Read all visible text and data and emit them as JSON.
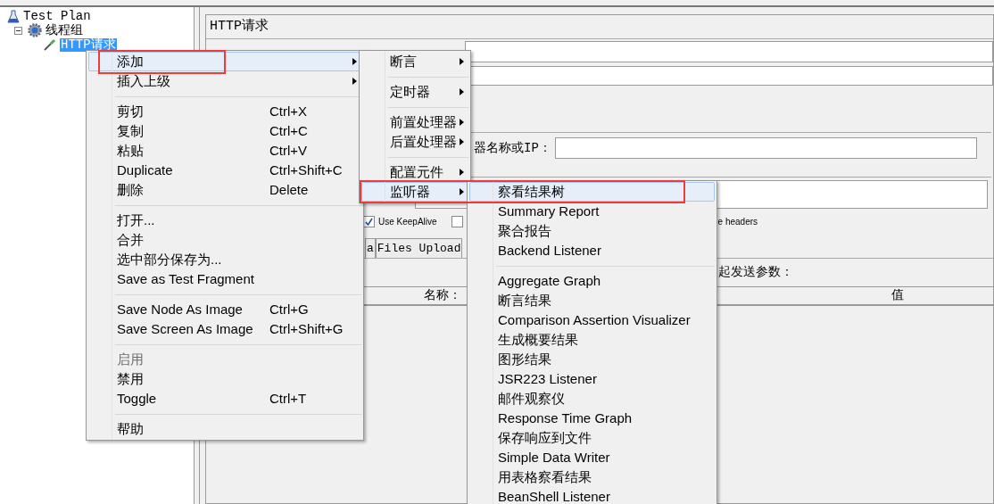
{
  "tree": [
    {
      "label": "Test Plan",
      "kind": "plan",
      "selected": false,
      "children": [
        {
          "label": "线程组",
          "kind": "group",
          "expanded": true,
          "selected": false,
          "children": [
            {
              "label": "HTTP请求",
              "kind": "sampler",
              "selected": true
            }
          ]
        }
      ]
    }
  ],
  "panel": {
    "title": "HTTP请求",
    "server_label": "器名称或IP：",
    "keepalive": {
      "label": "Use KeepAlive",
      "checked": true
    },
    "checkbox_2": {
      "checked": false
    },
    "headers_label": "e headers",
    "tabs": [
      {
        "label": "a",
        "selected": false
      },
      {
        "label": "Files Upload",
        "selected": false
      }
    ],
    "params_label": "起发送参数：",
    "table": {
      "columns": [
        "名称：",
        "值"
      ]
    }
  },
  "context_menu": {
    "items": [
      {
        "kind": "item",
        "label": "添加",
        "has_submenu": true,
        "selected": true,
        "disabled": false
      },
      {
        "kind": "item",
        "label": "插入上级",
        "has_submenu": true,
        "selected": false,
        "disabled": false
      },
      {
        "kind": "separator"
      },
      {
        "kind": "item",
        "label": "剪切",
        "shortcut": "Ctrl+X",
        "has_submenu": false,
        "selected": false,
        "disabled": false
      },
      {
        "kind": "item",
        "label": "复制",
        "shortcut": "Ctrl+C",
        "has_submenu": false,
        "selected": false,
        "disabled": false
      },
      {
        "kind": "item",
        "label": "粘贴",
        "shortcut": "Ctrl+V",
        "has_submenu": false,
        "selected": false,
        "disabled": false
      },
      {
        "kind": "item",
        "label": "Duplicate",
        "shortcut": "Ctrl+Shift+C",
        "has_submenu": false,
        "selected": false,
        "disabled": false
      },
      {
        "kind": "item",
        "label": "删除",
        "shortcut": "Delete",
        "has_submenu": false,
        "selected": false,
        "disabled": false
      },
      {
        "kind": "separator"
      },
      {
        "kind": "item",
        "label": "打开...",
        "has_submenu": false,
        "selected": false,
        "disabled": false
      },
      {
        "kind": "item",
        "label": "合并",
        "has_submenu": false,
        "selected": false,
        "disabled": false
      },
      {
        "kind": "item",
        "label": "选中部分保存为...",
        "has_submenu": false,
        "selected": false,
        "disabled": false
      },
      {
        "kind": "item",
        "label": "Save as Test Fragment",
        "has_submenu": false,
        "selected": false,
        "disabled": false
      },
      {
        "kind": "separator"
      },
      {
        "kind": "item",
        "label": "Save Node As Image",
        "shortcut": "Ctrl+G",
        "has_submenu": false,
        "selected": false,
        "disabled": false
      },
      {
        "kind": "item",
        "label": "Save Screen As Image",
        "shortcut": "Ctrl+Shift+G",
        "has_submenu": false,
        "selected": false,
        "disabled": false
      },
      {
        "kind": "separator"
      },
      {
        "kind": "item",
        "label": "启用",
        "has_submenu": false,
        "selected": false,
        "disabled": true
      },
      {
        "kind": "item",
        "label": "禁用",
        "has_submenu": false,
        "selected": false,
        "disabled": false
      },
      {
        "kind": "item",
        "label": "Toggle",
        "shortcut": "Ctrl+T",
        "has_submenu": false,
        "selected": false,
        "disabled": false
      },
      {
        "kind": "separator"
      },
      {
        "kind": "item",
        "label": "帮助",
        "has_submenu": false,
        "selected": false,
        "disabled": false
      }
    ]
  },
  "add_submenu": {
    "items": [
      {
        "kind": "item",
        "label": "断言",
        "has_submenu": true,
        "selected": false
      },
      {
        "kind": "separator"
      },
      {
        "kind": "item",
        "label": "定时器",
        "has_submenu": true,
        "selected": false
      },
      {
        "kind": "separator"
      },
      {
        "kind": "item",
        "label": "前置处理器",
        "has_submenu": true,
        "selected": false
      },
      {
        "kind": "item",
        "label": "后置处理器",
        "has_submenu": true,
        "selected": false
      },
      {
        "kind": "separator"
      },
      {
        "kind": "item",
        "label": "配置元件",
        "has_submenu": true,
        "selected": false
      },
      {
        "kind": "item",
        "label": "监听器",
        "has_submenu": true,
        "selected": true
      }
    ]
  },
  "listener_submenu": {
    "items": [
      {
        "kind": "item",
        "label": "察看结果树",
        "selected": true
      },
      {
        "kind": "item",
        "label": "Summary Report",
        "selected": false
      },
      {
        "kind": "item",
        "label": "聚合报告",
        "selected": false
      },
      {
        "kind": "item",
        "label": "Backend Listener",
        "selected": false
      },
      {
        "kind": "separator"
      },
      {
        "kind": "item",
        "label": "Aggregate Graph",
        "selected": false
      },
      {
        "kind": "item",
        "label": "断言结果",
        "selected": false
      },
      {
        "kind": "item",
        "label": "Comparison Assertion Visualizer",
        "selected": false
      },
      {
        "kind": "item",
        "label": "生成概要结果",
        "selected": false
      },
      {
        "kind": "item",
        "label": "图形结果",
        "selected": false
      },
      {
        "kind": "item",
        "label": "JSR223 Listener",
        "selected": false
      },
      {
        "kind": "item",
        "label": "邮件观察仪",
        "selected": false
      },
      {
        "kind": "item",
        "label": "Response Time Graph",
        "selected": false
      },
      {
        "kind": "item",
        "label": "保存响应到文件",
        "selected": false
      },
      {
        "kind": "item",
        "label": "Simple Data Writer",
        "selected": false
      },
      {
        "kind": "item",
        "label": "用表格察看结果",
        "selected": false
      },
      {
        "kind": "item",
        "label": "BeanShell Listener",
        "selected": false
      }
    ]
  }
}
